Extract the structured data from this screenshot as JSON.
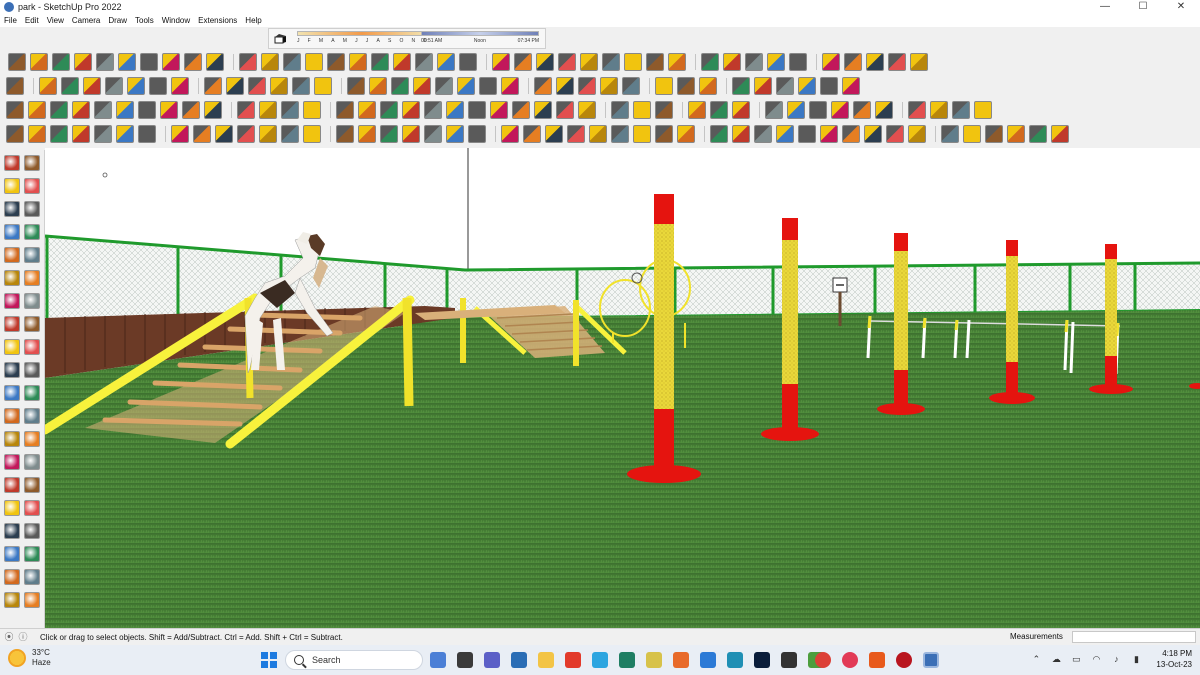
{
  "window": {
    "title": "park - SketchUp Pro 2022",
    "controls": {
      "minimize": "—",
      "maximize": "☐",
      "close": "✕"
    }
  },
  "menu": [
    "File",
    "Edit",
    "View",
    "Camera",
    "Draw",
    "Tools",
    "Window",
    "Extensions",
    "Help"
  ],
  "shadow_settings": {
    "months": [
      "J",
      "F",
      "M",
      "A",
      "M",
      "J",
      "J",
      "A",
      "S",
      "O",
      "N",
      "D"
    ],
    "sunrise": "06:51 AM",
    "noon": "Noon",
    "sunset": "07:34 PM"
  },
  "status": {
    "hint": "Click or drag to select objects. Shift = Add/Subtract. Ctrl = Add. Shift + Ctrl = Subtract.",
    "measurements_label": "Measurements",
    "measurements_value": ""
  },
  "taskbar": {
    "weather_temp": "33°C",
    "weather_desc": "Haze",
    "search_label": "Search",
    "time": "4:18 PM",
    "date": "13-Oct-23"
  },
  "icons": {
    "app": "sketchup-icon",
    "tray": [
      "chevron-up-icon",
      "cloud-icon",
      "network-icon",
      "wifi-icon",
      "volume-icon",
      "battery-icon"
    ]
  },
  "colors": {
    "pole_red": "#e5140f",
    "pole_yellow": "#f1e22b",
    "grass": "#3f7a33",
    "fence_green": "#1f9a2c",
    "ramp_yellow": "#f8f23c",
    "ramp_wood": "#d9b07a"
  }
}
